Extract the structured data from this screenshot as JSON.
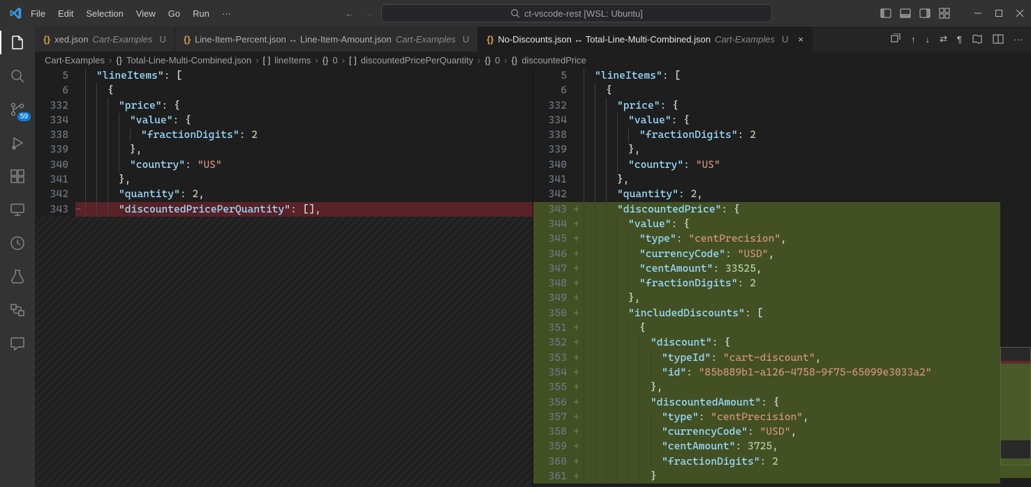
{
  "titlebar": {
    "menu": [
      "File",
      "Edit",
      "Selection",
      "View",
      "Go",
      "Run"
    ],
    "menu_overflow": "···",
    "search_text": "ct-vscode-rest [WSL: Ubuntu]"
  },
  "activitybar": {
    "source_control_badge": "59"
  },
  "tabs": [
    {
      "icon": "{}",
      "label": "xed.json",
      "sub": "Cart-Examples",
      "mod": "U",
      "active": false,
      "close": ""
    },
    {
      "icon": "{}",
      "label": "Line-Item-Percent.json ↔ Line-Item-Amount.json",
      "sub": "Cart-Examples",
      "mod": "U",
      "active": false,
      "close": ""
    },
    {
      "icon": "{}",
      "label": "No-Discounts.json ↔ Total-Line-Multi-Combined.json",
      "sub": "Cart-Examples",
      "mod": "U",
      "active": true,
      "close": "×"
    }
  ],
  "breadcrumb": [
    {
      "t": "Cart-Examples",
      "icon": ""
    },
    {
      "t": "Total-Line-Multi-Combined.json",
      "icon": "{}"
    },
    {
      "t": "lineItems",
      "icon": "[ ]"
    },
    {
      "t": "0",
      "icon": "{}"
    },
    {
      "t": "discountedPricePerQuantity",
      "icon": "[ ]"
    },
    {
      "t": "0",
      "icon": "{}"
    },
    {
      "t": "discountedPrice",
      "icon": "{}"
    }
  ],
  "left_pane": {
    "lines": [
      {
        "num": "5",
        "ind": 1,
        "cls": "",
        "tokens": [
          [
            "k",
            "\"lineItems\""
          ],
          [
            "p",
            ": ["
          ]
        ]
      },
      {
        "num": "6",
        "ind": 2,
        "cls": "",
        "tokens": [
          [
            "p",
            "{"
          ]
        ]
      },
      {
        "num": "332",
        "ind": 3,
        "cls": "",
        "tokens": [
          [
            "k",
            "\"price\""
          ],
          [
            "p",
            ": {"
          ]
        ]
      },
      {
        "num": "334",
        "ind": 4,
        "cls": "",
        "tokens": [
          [
            "k",
            "\"value\""
          ],
          [
            "p",
            ": {"
          ]
        ]
      },
      {
        "num": "338",
        "ind": 5,
        "cls": "",
        "tokens": [
          [
            "k",
            "\"fractionDigits\""
          ],
          [
            "p",
            ": "
          ],
          [
            "n",
            "2"
          ]
        ]
      },
      {
        "num": "339",
        "ind": 4,
        "cls": "",
        "tokens": [
          [
            "p",
            "},"
          ]
        ]
      },
      {
        "num": "340",
        "ind": 4,
        "cls": "",
        "tokens": [
          [
            "k",
            "\"country\""
          ],
          [
            "p",
            ": "
          ],
          [
            "s",
            "\"US\""
          ]
        ]
      },
      {
        "num": "341",
        "ind": 3,
        "cls": "",
        "tokens": [
          [
            "p",
            "},"
          ]
        ]
      },
      {
        "num": "342",
        "ind": 3,
        "cls": "",
        "tokens": [
          [
            "k",
            "\"quantity\""
          ],
          [
            "p",
            ": "
          ],
          [
            "n",
            "2"
          ],
          [
            "p",
            ","
          ]
        ]
      },
      {
        "num": "343",
        "ind": 3,
        "cls": "del",
        "sign": "−",
        "tokens": [
          [
            "k",
            "\"discountedPricePerQuantity\""
          ],
          [
            "p",
            ": [],"
          ]
        ]
      }
    ],
    "filler_top_idx": 10
  },
  "right_pane": {
    "lines": [
      {
        "num": "5",
        "ind": 1,
        "cls": "",
        "tokens": [
          [
            "k",
            "\"lineItems\""
          ],
          [
            "p",
            ": ["
          ]
        ]
      },
      {
        "num": "6",
        "ind": 2,
        "cls": "",
        "tokens": [
          [
            "p",
            "{"
          ]
        ]
      },
      {
        "num": "332",
        "ind": 3,
        "cls": "",
        "tokens": [
          [
            "k",
            "\"price\""
          ],
          [
            "p",
            ": {"
          ]
        ]
      },
      {
        "num": "334",
        "ind": 4,
        "cls": "",
        "tokens": [
          [
            "k",
            "\"value\""
          ],
          [
            "p",
            ": {"
          ]
        ]
      },
      {
        "num": "338",
        "ind": 5,
        "cls": "",
        "tokens": [
          [
            "k",
            "\"fractionDigits\""
          ],
          [
            "p",
            ": "
          ],
          [
            "n",
            "2"
          ]
        ]
      },
      {
        "num": "339",
        "ind": 4,
        "cls": "",
        "tokens": [
          [
            "p",
            "},"
          ]
        ]
      },
      {
        "num": "340",
        "ind": 4,
        "cls": "",
        "tokens": [
          [
            "k",
            "\"country\""
          ],
          [
            "p",
            ": "
          ],
          [
            "s",
            "\"US\""
          ]
        ]
      },
      {
        "num": "341",
        "ind": 3,
        "cls": "",
        "tokens": [
          [
            "p",
            "},"
          ]
        ]
      },
      {
        "num": "342",
        "ind": 3,
        "cls": "",
        "tokens": [
          [
            "k",
            "\"quantity\""
          ],
          [
            "p",
            ": "
          ],
          [
            "n",
            "2"
          ],
          [
            "p",
            ","
          ]
        ]
      },
      {
        "num": "343",
        "ind": 3,
        "cls": "add",
        "sign": "+",
        "tokens": [
          [
            "k",
            "\"discountedPrice\""
          ],
          [
            "p",
            ": {"
          ]
        ]
      },
      {
        "num": "344",
        "ind": 4,
        "cls": "add",
        "sign": "+",
        "tokens": [
          [
            "k",
            "\"value\""
          ],
          [
            "p",
            ": {"
          ]
        ]
      },
      {
        "num": "345",
        "ind": 5,
        "cls": "add",
        "sign": "+",
        "tokens": [
          [
            "k",
            "\"type\""
          ],
          [
            "p",
            ": "
          ],
          [
            "s",
            "\"centPrecision\""
          ],
          [
            "p",
            ","
          ]
        ]
      },
      {
        "num": "346",
        "ind": 5,
        "cls": "add",
        "sign": "+",
        "tokens": [
          [
            "k",
            "\"currencyCode\""
          ],
          [
            "p",
            ": "
          ],
          [
            "s",
            "\"USD\""
          ],
          [
            "p",
            ","
          ]
        ]
      },
      {
        "num": "347",
        "ind": 5,
        "cls": "add",
        "sign": "+",
        "tokens": [
          [
            "k",
            "\"centAmount\""
          ],
          [
            "p",
            ": "
          ],
          [
            "n",
            "33525"
          ],
          [
            "p",
            ","
          ]
        ]
      },
      {
        "num": "348",
        "ind": 5,
        "cls": "add",
        "sign": "+",
        "tokens": [
          [
            "k",
            "\"fractionDigits\""
          ],
          [
            "p",
            ": "
          ],
          [
            "n",
            "2"
          ]
        ]
      },
      {
        "num": "349",
        "ind": 4,
        "cls": "add",
        "sign": "+",
        "tokens": [
          [
            "p",
            "},"
          ]
        ]
      },
      {
        "num": "350",
        "ind": 4,
        "cls": "add",
        "sign": "+",
        "tokens": [
          [
            "k",
            "\"includedDiscounts\""
          ],
          [
            "p",
            ": ["
          ]
        ]
      },
      {
        "num": "351",
        "ind": 5,
        "cls": "add",
        "sign": "+",
        "tokens": [
          [
            "p",
            "{"
          ]
        ]
      },
      {
        "num": "352",
        "ind": 6,
        "cls": "add",
        "sign": "+",
        "tokens": [
          [
            "k",
            "\"discount\""
          ],
          [
            "p",
            ": {"
          ]
        ]
      },
      {
        "num": "353",
        "ind": 7,
        "cls": "add",
        "sign": "+",
        "tokens": [
          [
            "k",
            "\"typeId\""
          ],
          [
            "p",
            ": "
          ],
          [
            "s",
            "\"cart-discount\""
          ],
          [
            "p",
            ","
          ]
        ]
      },
      {
        "num": "354",
        "ind": 7,
        "cls": "add",
        "sign": "+",
        "tokens": [
          [
            "k",
            "\"id\""
          ],
          [
            "p",
            ": "
          ],
          [
            "s",
            "\"85b889b1-a126-4758-9f75-65099e3033a2\""
          ]
        ]
      },
      {
        "num": "355",
        "ind": 6,
        "cls": "add",
        "sign": "+",
        "tokens": [
          [
            "p",
            "},"
          ]
        ]
      },
      {
        "num": "356",
        "ind": 6,
        "cls": "add",
        "sign": "+",
        "tokens": [
          [
            "k",
            "\"discountedAmount\""
          ],
          [
            "p",
            ": {"
          ]
        ]
      },
      {
        "num": "357",
        "ind": 7,
        "cls": "add",
        "sign": "+",
        "tokens": [
          [
            "k",
            "\"type\""
          ],
          [
            "p",
            ": "
          ],
          [
            "s",
            "\"centPrecision\""
          ],
          [
            "p",
            ","
          ]
        ]
      },
      {
        "num": "358",
        "ind": 7,
        "cls": "add",
        "sign": "+",
        "tokens": [
          [
            "k",
            "\"currencyCode\""
          ],
          [
            "p",
            ": "
          ],
          [
            "s",
            "\"USD\""
          ],
          [
            "p",
            ","
          ]
        ]
      },
      {
        "num": "359",
        "ind": 7,
        "cls": "add",
        "sign": "+",
        "tokens": [
          [
            "k",
            "\"centAmount\""
          ],
          [
            "p",
            ": "
          ],
          [
            "n",
            "3725"
          ],
          [
            "p",
            ","
          ]
        ]
      },
      {
        "num": "360",
        "ind": 7,
        "cls": "add",
        "sign": "+",
        "tokens": [
          [
            "k",
            "\"fractionDigits\""
          ],
          [
            "p",
            ": "
          ],
          [
            "n",
            "2"
          ]
        ]
      },
      {
        "num": "361",
        "ind": 6,
        "cls": "add",
        "sign": "+",
        "tokens": [
          [
            "p",
            "}"
          ]
        ]
      }
    ]
  }
}
